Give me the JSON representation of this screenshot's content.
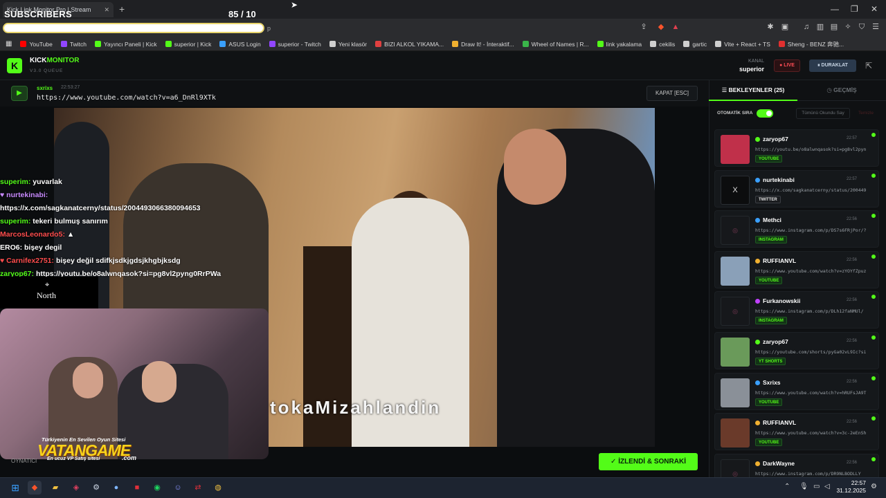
{
  "browser": {
    "tab_title": "Kick Link Monitor Pro | Stream",
    "new_tab": "+",
    "address_suffix": "p",
    "overlay_subscribers": "SUBSCRIBERS",
    "overlay_count": "85  / 10",
    "bookmarks": [
      {
        "label": "YouTube",
        "color": "#ff0000"
      },
      {
        "label": "Twitch",
        "color": "#9146ff"
      },
      {
        "label": "Yayıncı Paneli | Kick",
        "color": "#53fc18"
      },
      {
        "label": "superior | Kick",
        "color": "#53fc18"
      },
      {
        "label": "ASUS Login",
        "color": "#3aa0ff"
      },
      {
        "label": "superior - Twitch",
        "color": "#9146ff"
      },
      {
        "label": "Yeni klasör",
        "color": "#cfcfcf"
      },
      {
        "label": "BIZI ALKOL YIKAMA...",
        "color": "#e04040"
      },
      {
        "label": "Draw It! - İnteraktif...",
        "color": "#f0b030"
      },
      {
        "label": "Wheel of Names | R...",
        "color": "#3ab54a"
      },
      {
        "label": "link yakalama",
        "color": "#53fc18"
      },
      {
        "label": "cekilis",
        "color": "#cfcfcf"
      },
      {
        "label": "gartic",
        "color": "#cfcfcf"
      },
      {
        "label": "Vite + React + TS",
        "color": "#cfcfcf"
      },
      {
        "label": "Sheng - BENZ 奔驰...",
        "color": "#e03030"
      }
    ]
  },
  "app": {
    "logo_letter": "K",
    "brand_a": "KICK",
    "brand_b": "MONITOR",
    "version": "V3.0 QUEUE",
    "kanal_label": "KANAL",
    "kanal_value": "superior",
    "live_label": "● LIVE",
    "pause_label": "⏸ DURAKLAT"
  },
  "now_playing": {
    "user": "sxrixs",
    "time": "22:53:27",
    "url": "https://www.youtube.com/watch?v=a6_DnRl9XTk",
    "close_label": "KAPAT [ESC]",
    "caption": "tokaMizahlandin"
  },
  "chat": [
    {
      "user": "superim:",
      "msg": " yuvarlak",
      "cls": "u-green"
    },
    {
      "user": "♥ nurtekinabi:",
      "msg": "",
      "cls": "u-purple"
    },
    {
      "user": "",
      "msg": "https://x.com/sagkanatcerny/status/2004493066380094653",
      "cls": "u-white"
    },
    {
      "user": "superim:",
      "msg": " tekeri bulmuş sanırım",
      "cls": "u-green"
    },
    {
      "user": "MarcosLeonardo5:",
      "msg": " ▲",
      "cls": "u-red"
    },
    {
      "user": "ERO6:",
      "msg": " bişey degil",
      "cls": "u-white"
    },
    {
      "user": "♥ Carnifex2751:",
      "msg": " bişey değil sdifkjsdkjgdsjkhgbjksdg",
      "cls": "u-red"
    },
    {
      "user": "zaryop67:",
      "msg": " https://youtu.be/o8alwnqasok?si=pg8vl2pyng0RrPWa",
      "cls": "u-green"
    }
  ],
  "overlay": {
    "north": "North",
    "vatan_top": "Türkiyenin En Sevilen Oyun Sitesi",
    "vatan_main": "VATANGAME",
    "vatan_sub": "En ucuz VP Satış sitesi",
    "vatan_com": ".com",
    "oyna": "OYNATICI"
  },
  "actions": {
    "watched_label": "✓ İZLENDİ & SONRAKİ"
  },
  "queue": {
    "tab_waiting": "☰  BEKLEYENLER (25)",
    "tab_history": "◷  GEÇMİŞ",
    "auto_label": "OTOMATİK SIRA",
    "mark_all": "Tümünü Okundu Say",
    "clear": "Temizle",
    "items": [
      {
        "user": "zaryop67",
        "time": "22:57",
        "url": "https://youtu.be/o8alwnqasok?si=pg8vl2pyn...",
        "badge": "YOUTUBE",
        "kind": "yt",
        "dot": "#53fc18"
      },
      {
        "user": "nurtekinabi",
        "time": "22:57",
        "url": "https://x.com/sagkanatcerny/status/200449...",
        "badge": "TWITTER",
        "kind": "tw",
        "dot": "#3aa0ff"
      },
      {
        "user": "Methci",
        "time": "22:56",
        "url": "https://www.instagram.com/p/DS7s6FRjPor/?...",
        "badge": "INSTAGRAM",
        "kind": "ig",
        "dot": "#3aa0ff"
      },
      {
        "user": "RUFFIANVL",
        "time": "22:56",
        "url": "https://www.youtube.com/watch?v=zYOYfZpuz...",
        "badge": "YOUTUBE",
        "kind": "yt",
        "dot": "#f0b030"
      },
      {
        "user": "Furkanowskii",
        "time": "22:56",
        "url": "https://www.instagram.com/p/DLh12faNMUl/",
        "badge": "INSTAGRAM",
        "kind": "ig",
        "dot": "#c040ff"
      },
      {
        "user": "zaryop67",
        "time": "22:56",
        "url": "https://youtube.com/shorts/pyGa02vL9Ic?si...",
        "badge": "YT SHORTS",
        "kind": "ys",
        "dot": "#53fc18"
      },
      {
        "user": "Sxrixs",
        "time": "22:56",
        "url": "https://www.youtube.com/watch?v=hRUFsJA9T...",
        "badge": "YOUTUBE",
        "kind": "yt",
        "dot": "#3aa0ff"
      },
      {
        "user": "RUFFIANVL",
        "time": "22:56",
        "url": "https://www.youtube.com/watch?v=3c-2eEnSh...",
        "badge": "YOUTUBE",
        "kind": "yt",
        "dot": "#f0b030"
      },
      {
        "user": "DarkWayne",
        "time": "22:56",
        "url": "https://www.instagram.com/p/DR9NLBODLLY",
        "badge": "INSTAGRAM",
        "kind": "ig",
        "dot": "#f0b030"
      }
    ]
  },
  "taskbar": {
    "time": "22:57",
    "date": "31.12.2025"
  }
}
